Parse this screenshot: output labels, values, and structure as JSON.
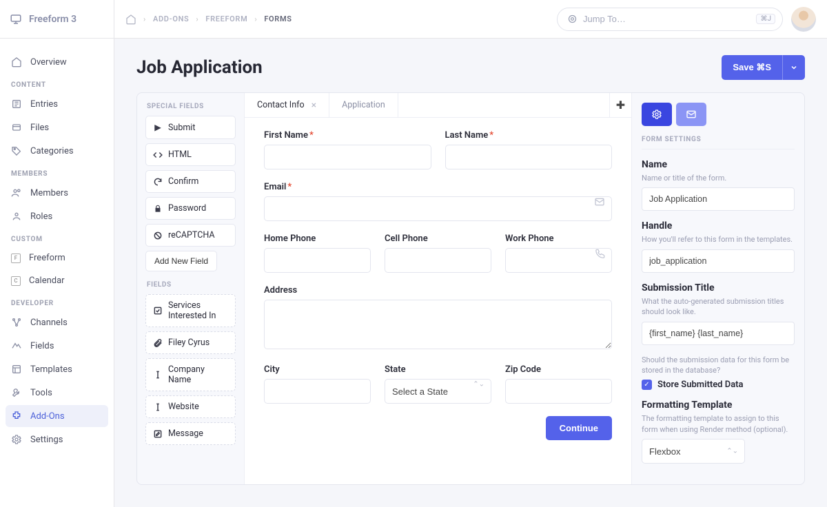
{
  "product": "Freeform 3",
  "breadcrumb": {
    "a": "ADD-ONS",
    "b": "FREEFORM",
    "c": "FORMS"
  },
  "search": {
    "placeholder": "Jump To…",
    "shortcut": "⌘J"
  },
  "sidebar": {
    "overview": "Overview",
    "groups": [
      {
        "title": "CONTENT",
        "items": [
          {
            "label": "Entries"
          },
          {
            "label": "Files"
          },
          {
            "label": "Categories"
          }
        ]
      },
      {
        "title": "MEMBERS",
        "items": [
          {
            "label": "Members"
          },
          {
            "label": "Roles"
          }
        ]
      },
      {
        "title": "CUSTOM",
        "items": [
          {
            "label": "Freeform",
            "badge": "F"
          },
          {
            "label": "Calendar",
            "badge": "C"
          }
        ]
      },
      {
        "title": "DEVELOPER",
        "items": [
          {
            "label": "Channels"
          },
          {
            "label": "Fields"
          },
          {
            "label": "Templates"
          },
          {
            "label": "Tools"
          },
          {
            "label": "Add-Ons",
            "active": true
          },
          {
            "label": "Settings"
          }
        ]
      }
    ]
  },
  "page": {
    "title": "Job Application",
    "save": "Save ⌘S"
  },
  "fieldsColumn": {
    "specialTitle": "SPECIAL FIELDS",
    "special": [
      "Submit",
      "HTML",
      "Confirm",
      "Password",
      "reCAPTCHA"
    ],
    "addNew": "Add New Field",
    "fieldsTitle": "FIELDS",
    "fields": [
      "Services Interested In",
      "Filey Cyrus",
      "Company Name",
      "Website",
      "Message"
    ]
  },
  "tabs": {
    "a": "Contact Info",
    "b": "Application"
  },
  "form": {
    "firstName": "First Name",
    "lastName": "Last Name",
    "email": "Email",
    "homePhone": "Home Phone",
    "cellPhone": "Cell Phone",
    "workPhone": "Work Phone",
    "address": "Address",
    "city": "City",
    "state": "State",
    "statePlaceholder": "Select a State",
    "zip": "Zip Code",
    "continue": "Continue"
  },
  "settings": {
    "title": "FORM SETTINGS",
    "name": {
      "label": "Name",
      "help": "Name or title of the form.",
      "value": "Job Application"
    },
    "handle": {
      "label": "Handle",
      "help": "How you'll refer to this form in the templates.",
      "value": "job_application"
    },
    "subTitle": {
      "label": "Submission Title",
      "help": "What the auto-generated submission titles should look like.",
      "value": "{first_name} {last_name}"
    },
    "storeHelp": "Should the submission data for this form be stored in the database?",
    "storeLabel": "Store Submitted Data",
    "format": {
      "label": "Formatting Template",
      "help": "The formatting template to assign to this form when using Render method (optional).",
      "value": "Flexbox"
    }
  }
}
